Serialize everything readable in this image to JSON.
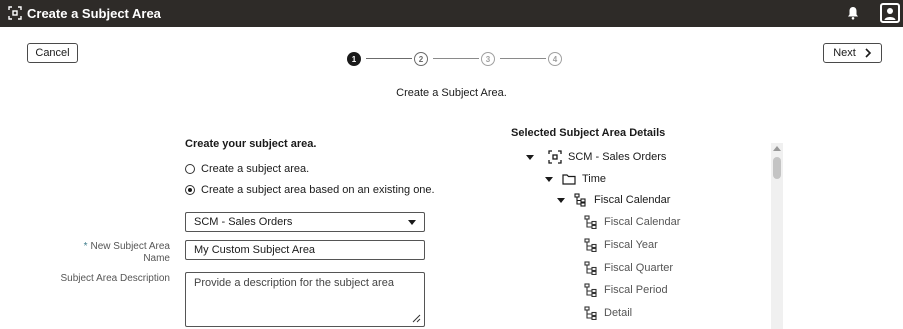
{
  "window": {
    "title": "Create a Subject Area",
    "app_icon": "dataset-icon",
    "bell_icon": "bell-icon",
    "user_icon": "user-avatar-icon"
  },
  "toolbar": {
    "cancel_label": "Cancel",
    "next_label": "Next"
  },
  "steps": [
    {
      "number": "1",
      "state": "active"
    },
    {
      "number": "2",
      "state": "upcoming"
    },
    {
      "number": "3",
      "state": "upcoming"
    },
    {
      "number": "4",
      "state": "upcoming"
    }
  ],
  "subtitle": "Create a Subject Area.",
  "form": {
    "heading": "Create your subject area.",
    "option_new": "Create a subject area.",
    "option_existing": "Create a subject area based on an existing one.",
    "selected_option": "option_existing",
    "base_select_value": "SCM - Sales Orders",
    "name_label_required": "*",
    "name_label": "New Subject Area Name",
    "name_value": "My Custom Subject Area",
    "desc_label": "Subject Area Description",
    "desc_placeholder": "Provide a description for the subject area"
  },
  "details": {
    "heading": "Selected Subject Area Details",
    "tree": {
      "root": "SCM - Sales Orders",
      "folder": "Time",
      "hierarchy": "Fiscal Calendar",
      "levels": [
        "Fiscal Calendar",
        "Fiscal Year",
        "Fiscal Quarter",
        "Fiscal Period",
        "Detail"
      ]
    }
  }
}
